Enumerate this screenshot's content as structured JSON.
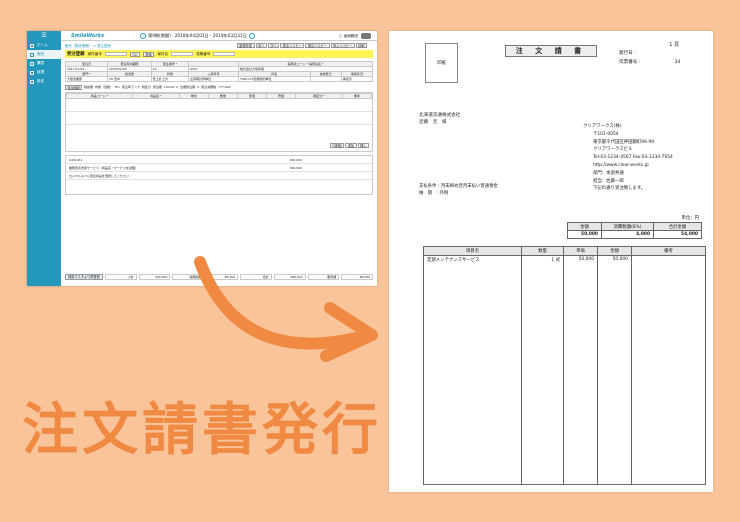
{
  "caption": "注文請書発行",
  "app": {
    "logo": "SmileWorks",
    "period": "第9期(期間) : 2018年04月01日 - 2019年03月31日",
    "prev_icon": "chevron-left-icon",
    "next_icon": "chevron-right-icon",
    "top_right": "ⓘ 画面解説",
    "side_menu": [
      {
        "label": "ホーム",
        "icon": "home-icon"
      },
      {
        "label": "販売",
        "icon": "cart-icon",
        "active": true
      },
      {
        "label": "購買",
        "icon": "box-icon"
      },
      {
        "label": "経理",
        "icon": "yen-icon"
      },
      {
        "label": "設定",
        "icon": "gear-icon"
      }
    ],
    "breadcrumb": "販売（販売業務） > 受注登録",
    "toolbar": [
      "新規作成",
      "前へ",
      "次へ",
      "受注ヘコピー",
      "発注ヘコピー",
      "売上ヘコピー",
      "印刷",
      "印刷"
    ],
    "title": "受注登録",
    "title_fields": [
      "案件番号",
      "GO",
      "検索",
      "案件名",
      "見積番号"
    ],
    "grid_header1": [
      "受注日",
      "受注有効期限",
      "受注番号 *",
      "",
      "得意先コード * 得意先名 *"
    ],
    "grid_row1": [
      "2017/12/22",
      "2018/02/28",
      "10",
      "0027",
      "株式会社大場商事"
    ],
    "grid_header2": [
      "部門 *",
      "担当者",
      "状態",
      "入荷年月",
      "件名",
      "請求区分",
      "承認状況"
    ],
    "grid_row2": [
      "大阪営業部",
      "TR 田中",
      "売上計上済",
      "出荷時計算単位",
      "TORI-CHI定額契約単位",
      "",
      "承認済"
    ],
    "sec_bar": [
      "受注明細",
      "税抜額",
      "内税（自動）",
      "8%",
      "受注率ランク",
      "税区分",
      "受注額",
      "100.00 %",
      "全額受注額",
      "0",
      "受注消費税",
      "777,600"
    ],
    "lines_header": [
      "商品コード *",
      "商品名 *",
      "単位",
      "数量",
      "原価",
      "売価",
      "税区分 *",
      "備考"
    ],
    "lines_buttons": [
      "行削除",
      "追加",
      "挿入"
    ],
    "sub_rows": [
      "CAM-011",
      "業務改善支援サービス（商品名・サービスを記載）",
      "ロジカル＆フル受注商品を選択してください"
    ],
    "sub_values": [
      "300,000",
      "300,000",
      "300,000"
    ],
    "footer_button": "構造マスタより再登録",
    "footer_fields": [
      "小計",
      "300,000",
      "消費税額",
      "28,400",
      "合計",
      "388,400",
      "粗利額",
      "86,000"
    ]
  },
  "document": {
    "page": "1 頁",
    "stamp": "印紙",
    "title": "注 文 請 書",
    "issue_date_label": "発行日 :",
    "issue_date": "",
    "doc_no_label": "伝票番号 :",
    "doc_no": "34",
    "customer": {
      "company": "北海道流通株式会社",
      "person": "近藤　元　様"
    },
    "supplier": [
      "クリアワークス(株)",
      "〒101-0054",
      "東京都千代田区神田錦町96-99",
      "クリアワークスビル",
      "Tel:03-1234-4567  Fax:03-1234-7654",
      "http://www.clear-works.jp",
      "部門：本部共通",
      "担当：佐藤一郎",
      "下記の通り受注致します。"
    ],
    "conditions": [
      {
        "label": "支払条件 :",
        "value": "月末締め翌月末払い普通預金"
      },
      {
        "label": "納　期　:",
        "value": "外税"
      }
    ],
    "unit": "単位：円",
    "totals_header": [
      "金額",
      "消費税額(8%)",
      "合計金額"
    ],
    "totals_values": [
      "50,000",
      "4,000",
      "54,000"
    ],
    "items_header": [
      "項目名",
      "数量",
      "単価",
      "金額",
      "備考"
    ],
    "items": [
      {
        "name": "定期メンテナンスサービス",
        "qty": "1 式",
        "price": "50,000",
        "amount": "50,000",
        "note": ""
      }
    ]
  },
  "colors": {
    "background": "#f9c49a",
    "caption": "#f08a42",
    "arrow": "#f08a42",
    "sidebar": "#2497bc",
    "title_bar": "#fff455"
  }
}
